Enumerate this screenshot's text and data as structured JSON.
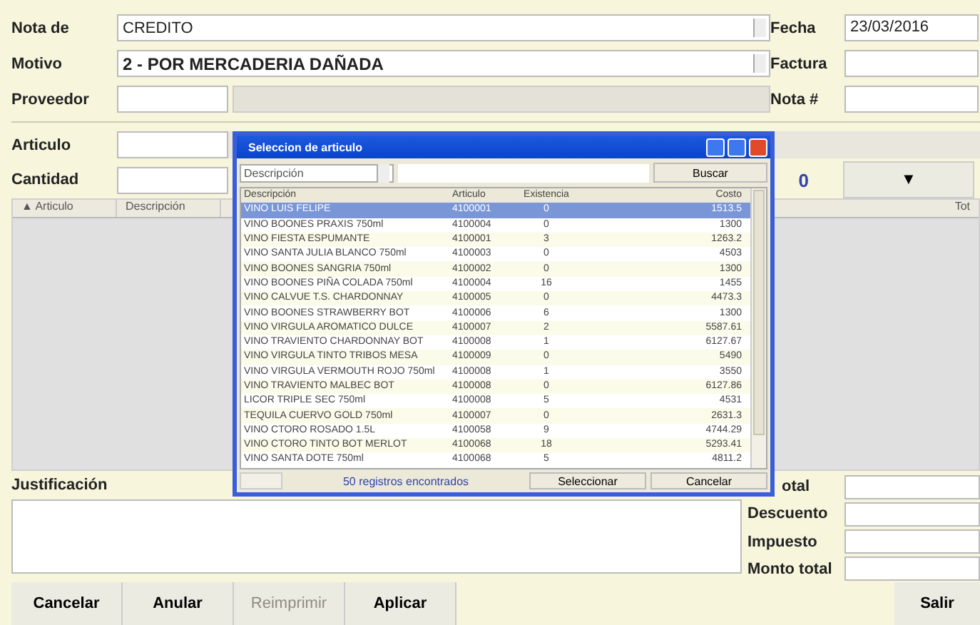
{
  "header": {
    "nota_de_label": "Nota de",
    "nota_de_value": "CREDITO",
    "fecha_label": "Fecha",
    "fecha_value": "23/03/2016",
    "motivo_label": "Motivo",
    "motivo_value": "2 - POR MERCADERIA DAÑADA",
    "factura_label": "Factura",
    "proveedor_label": "Proveedor",
    "nota_num_label": "Nota #"
  },
  "item_entry": {
    "articulo_label": "Articulo",
    "cantidad_label": "Cantidad",
    "count": "0",
    "dropdown_button": "▼"
  },
  "grid": {
    "columns": [
      "▲ Articulo",
      "Descripción"
    ],
    "column_right": "Tot"
  },
  "justification_label": "Justificación",
  "totals": [
    {
      "label": "otal"
    },
    {
      "label": "Descuento"
    },
    {
      "label": "Impuesto"
    },
    {
      "label": "Monto total"
    }
  ],
  "buttons": [
    {
      "label": "Cancelar",
      "disabled": false
    },
    {
      "label": "Anular",
      "disabled": false
    },
    {
      "label": "Reimprimir",
      "disabled": true
    },
    {
      "label": "Aplicar",
      "disabled": false
    }
  ],
  "exit_button": "Salir",
  "dialog": {
    "title": "Seleccion de articulo",
    "search_by": "Descripción",
    "search_button": "Buscar",
    "columns": [
      "Descripción",
      "Articulo",
      "Existencia",
      "Costo"
    ],
    "rows": [
      {
        "cells": [
          "VINO LUIS FELIPE",
          "4100001",
          "0",
          "1513.5"
        ],
        "selected": true
      },
      {
        "cells": [
          "VINO BOONES PRAXIS 750ml",
          "4100004",
          "0",
          "1300"
        ],
        "selected": false
      },
      {
        "cells": [
          "VINO FIESTA ESPUMANTE",
          "4100001",
          "3",
          "1263.2"
        ],
        "selected": false
      },
      {
        "cells": [
          "VINO SANTA JULIA BLANCO 750ml",
          "4100003",
          "0",
          "4503"
        ],
        "selected": false
      },
      {
        "cells": [
          "VINO BOONES SANGRIA 750ml",
          "4100002",
          "0",
          "1300"
        ],
        "selected": false
      },
      {
        "cells": [
          "VINO BOONES PIÑA COLADA 750ml",
          "4100004",
          "16",
          "1455"
        ],
        "selected": false
      },
      {
        "cells": [
          "VINO CALVUE T.S. CHARDONNAY",
          "4100005",
          "0",
          "4473.3"
        ],
        "selected": false
      },
      {
        "cells": [
          "VINO BOONES STRAWBERRY BOT",
          "4100006",
          "6",
          "1300"
        ],
        "selected": false
      },
      {
        "cells": [
          "VINO VIRGULA AROMATICO DULCE",
          "4100007",
          "2",
          "5587.61"
        ],
        "selected": false
      },
      {
        "cells": [
          "VINO TRAVIENTO CHARDONNAY BOT",
          "4100008",
          "1",
          "6127.67"
        ],
        "selected": false
      },
      {
        "cells": [
          "VINO VIRGULA TINTO TRIBOS MESA",
          "4100009",
          "0",
          "5490"
        ],
        "selected": false
      },
      {
        "cells": [
          "VINO VIRGULA VERMOUTH ROJO 750ml",
          "4100008",
          "1",
          "3550"
        ],
        "selected": false
      },
      {
        "cells": [
          "VINO TRAVIENTO MALBEC BOT",
          "4100008",
          "0",
          "6127.86"
        ],
        "selected": false
      },
      {
        "cells": [
          "LICOR TRIPLE SEC 750ml",
          "4100008",
          "5",
          "4531"
        ],
        "selected": false
      },
      {
        "cells": [
          "TEQUILA CUERVO GOLD 750ml",
          "4100007",
          "0",
          "2631.3"
        ],
        "selected": false
      },
      {
        "cells": [
          "VINO CTORO ROSADO 1.5L",
          "4100058",
          "9",
          "4744.29"
        ],
        "selected": false
      },
      {
        "cells": [
          "VINO CTORO TINTO BOT MERLOT",
          "4100068",
          "18",
          "5293.41"
        ],
        "selected": false
      },
      {
        "cells": [
          "VINO SANTA DOTE 750ml",
          "4100068",
          "5",
          "4811.2"
        ],
        "selected": false
      }
    ],
    "found": "50 registros encontrados",
    "select_button": "Seleccionar",
    "cancel_button": "Cancelar"
  }
}
